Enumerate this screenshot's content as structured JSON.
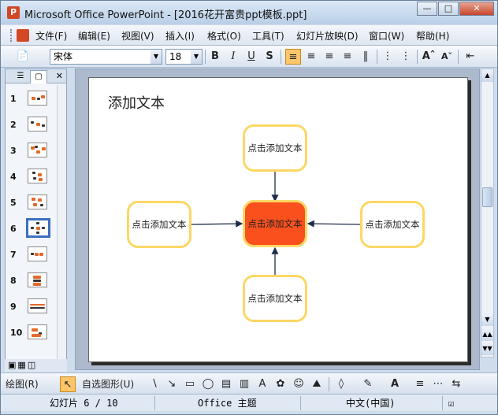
{
  "window": {
    "title": "Microsoft Office PowerPoint - [2016花开富贵ppt模板.ppt]"
  },
  "menu": [
    "文件(F)",
    "编辑(E)",
    "视图(V)",
    "插入(I)",
    "格式(O)",
    "工具(T)",
    "幻灯片放映(D)",
    "窗口(W)",
    "帮助(H)"
  ],
  "toolbar": {
    "font": "宋体",
    "size": "18"
  },
  "thumbnails": [
    "1",
    "2",
    "3",
    "4",
    "5",
    "6",
    "7",
    "8",
    "9",
    "10"
  ],
  "slide": {
    "title": "添加文本",
    "top": "点击添加文本",
    "left": "点击添加文本",
    "center": "点击添加文本",
    "right": "点击添加文本",
    "bottom": "点击添加文本"
  },
  "drawing": {
    "draw": "绘图(R)",
    "autoshapes": "自选图形(U)"
  },
  "status": {
    "slide": "幻灯片 6 / 10",
    "theme": "Office 主题",
    "lang": "中文(中国)"
  },
  "colors": {
    "center_box": "#f9501e",
    "box_border": "#fcd765",
    "selected_thumb": "#3b6fbf"
  }
}
